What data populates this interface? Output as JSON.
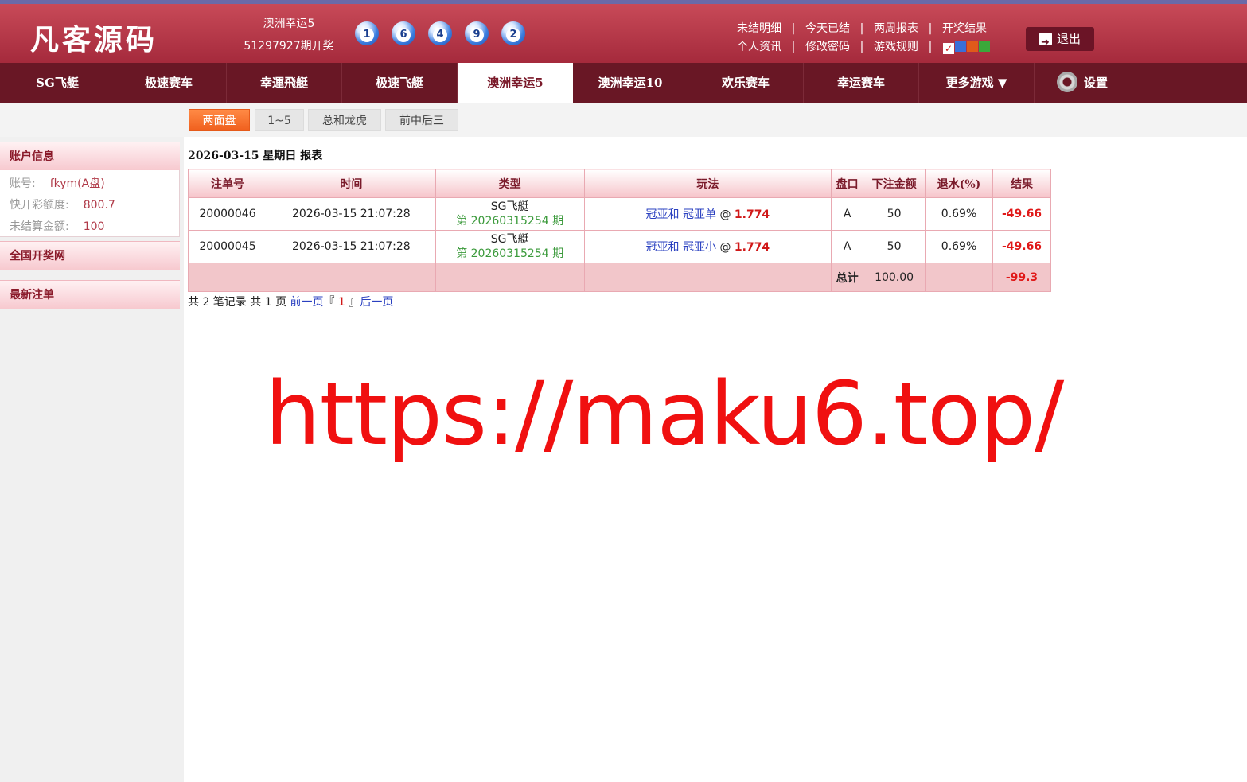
{
  "header": {
    "logo": "凡客源码",
    "lottery_name": "澳洲幸运5",
    "lottery_issue": "51297927期开奖",
    "balls": [
      "1",
      "6",
      "4",
      "9",
      "2"
    ],
    "links_row1": [
      "未结明细",
      "今天已结",
      "两周报表",
      "开奖结果"
    ],
    "links_row2": [
      "个人资讯",
      "修改密码",
      "游戏规则"
    ],
    "separator": "|",
    "skin_colors": [
      "#ffffff",
      "#3a6fd8",
      "#e05a1a",
      "#3aa83a"
    ],
    "logout_label": "退出"
  },
  "nav": {
    "items": [
      "SG飞艇",
      "极速赛车",
      "幸運飛艇",
      "极速飞艇",
      "澳洲幸运5",
      "澳洲幸运10",
      "欢乐赛车",
      "幸运赛车",
      "更多游戏 ▼"
    ],
    "active_index": 4,
    "settings_label": "设置"
  },
  "subtabs": [
    "两面盘",
    "1~5",
    "总和龙虎",
    "前中后三"
  ],
  "sidebar": {
    "account_title": "账户信息",
    "account_rows": [
      {
        "label": "账号:",
        "value": "fkym(A盘)"
      },
      {
        "label": "快开彩额度:",
        "value": "800.7"
      },
      {
        "label": "未结算金额:",
        "value": "100"
      }
    ],
    "section2": "全国开奖网",
    "section3": "最新注单"
  },
  "report": {
    "title": "2026-03-15 星期日 报表",
    "columns": [
      "注单号",
      "时间",
      "类型",
      "玩法",
      "盘口",
      "下注金额",
      "退水(%)",
      "结果"
    ],
    "rows": [
      {
        "id": "20000046",
        "time": "2026-03-15 21:07:28",
        "game": "SG飞艇",
        "issue": "第 20260315254 期",
        "play1": "冠亚和",
        "play2": "冠亚单",
        "at": "@",
        "odds": "1.774",
        "pan": "A",
        "amount": "50",
        "rebate": "0.69%",
        "result": "-49.66"
      },
      {
        "id": "20000045",
        "time": "2026-03-15 21:07:28",
        "game": "SG飞艇",
        "issue": "第 20260315254 期",
        "play1": "冠亚和",
        "play2": "冠亚小",
        "at": "@",
        "odds": "1.774",
        "pan": "A",
        "amount": "50",
        "rebate": "0.69%",
        "result": "-49.66"
      }
    ],
    "total_label": "总计",
    "total_amount": "100.00",
    "total_result": "-99.3"
  },
  "pager": {
    "prefix": "共 2 笔记录 共 1 页",
    "prev": "前一页",
    "open_bracket": "『",
    "current": "1",
    "close_bracket": "』",
    "next": "后一页"
  },
  "watermark": "https://maku6.top/"
}
